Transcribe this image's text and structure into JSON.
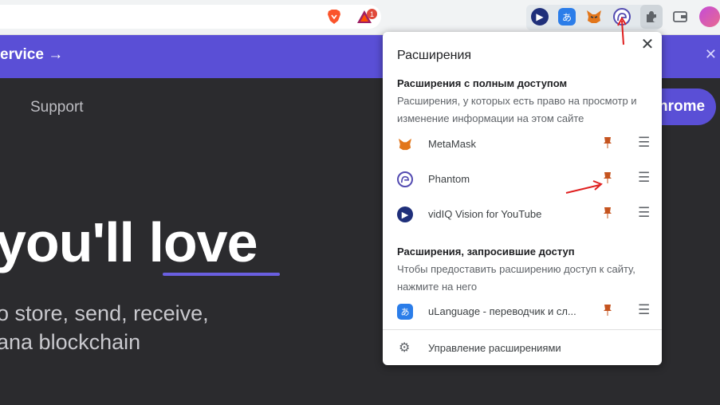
{
  "toolbar": {
    "extension_icons": [
      "brave-icon",
      "bat-icon",
      "vidiq-icon",
      "ulanguage-icon",
      "metamask-icon",
      "phantom-icon",
      "puzzle-icon",
      "wallet-icon",
      "avatar"
    ],
    "bat_badge": "1"
  },
  "page": {
    "banner_text": "ervice →",
    "support": "Support",
    "chrome_button": "hrome",
    "hero": "you'll love",
    "subtitle_line1": "o store, send, receive,",
    "subtitle_line2": "ana blockchain"
  },
  "popup": {
    "title": "Расширения",
    "full_access_heading": "Расширения с полным доступом",
    "full_access_desc": "Расширения, у которых есть право на просмотр и изменение информации на этом сайте",
    "full_access_items": [
      {
        "name": "MetaMask",
        "icon": "metamask-icon"
      },
      {
        "name": "Phantom",
        "icon": "phantom-icon"
      },
      {
        "name": "vidIQ Vision for YouTube",
        "icon": "vidiq-icon"
      }
    ],
    "requested_heading": "Расширения, запросившие доступ",
    "requested_desc": "Чтобы предоставить расширению доступ к сайту, нажмите на него",
    "requested_items": [
      {
        "name": "uLanguage - переводчик и сл...",
        "icon": "ulanguage-icon"
      }
    ],
    "manage_label": "Управление расширениями"
  },
  "colors": {
    "accent": "#5a4fd6",
    "pin": "#c5541f",
    "annotation_arrow": "#e02020"
  }
}
